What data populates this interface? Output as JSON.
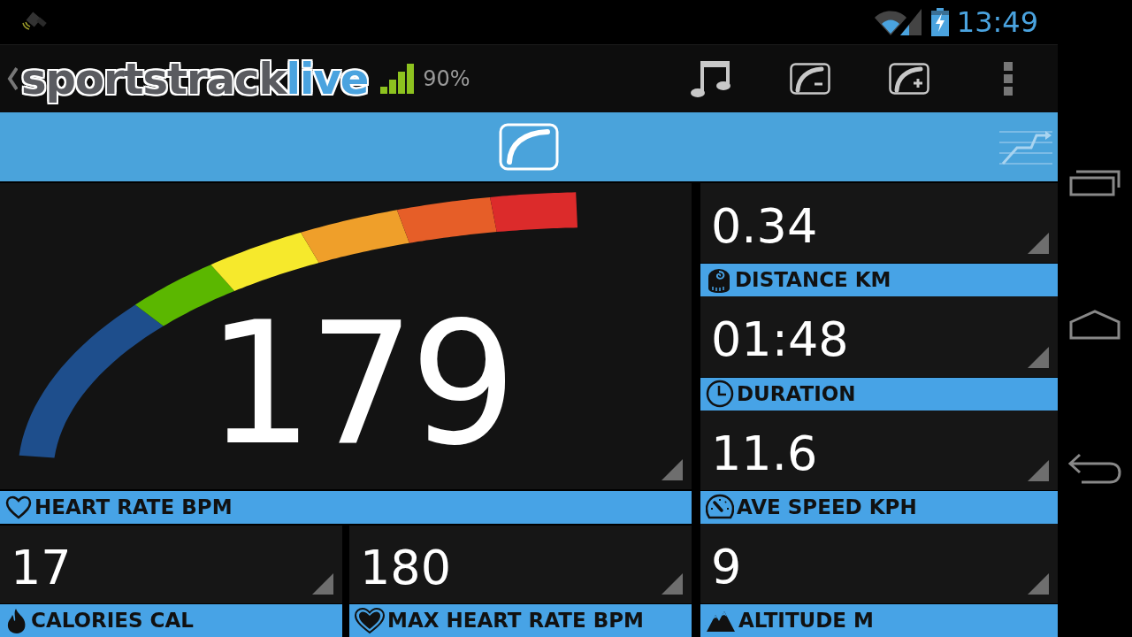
{
  "status_bar": {
    "time": "13:49"
  },
  "action_bar": {
    "logo": {
      "main": "sportstrack",
      "accent": "live"
    },
    "signal_reading": "90%"
  },
  "main_metric": {
    "value": "179",
    "label": "HEART RATE BPM"
  },
  "bottom_tiles": [
    {
      "value": "17",
      "label": "CALORIES CAL"
    },
    {
      "value": "180",
      "label": "MAX HEART RATE BPM"
    }
  ],
  "side_tiles": [
    {
      "value": "0.34",
      "label": "DISTANCE KM"
    },
    {
      "value": "01:48",
      "label": "DURATION"
    },
    {
      "value": "11.6",
      "label": "AVE SPEED KPH"
    },
    {
      "value": "9",
      "label": "ALTITUDE M"
    }
  ]
}
